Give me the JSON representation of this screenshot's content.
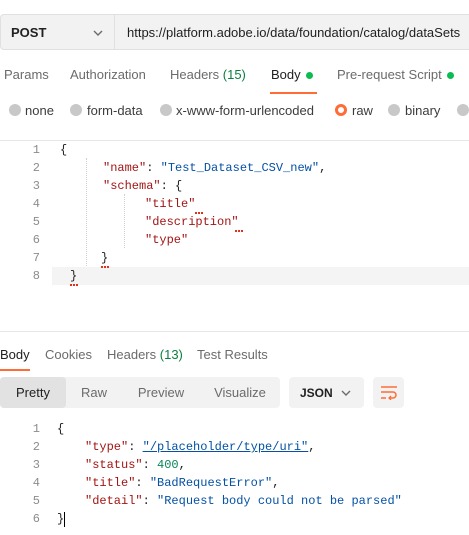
{
  "request": {
    "method": "POST",
    "url": "https://platform.adobe.io/data/foundation/catalog/dataSets"
  },
  "request_tabs": {
    "params": "Params",
    "authorization": "Authorization",
    "headers": "Headers",
    "headers_count": "(15)",
    "body": "Body",
    "prerequest": "Pre-request Script"
  },
  "body_types": {
    "none": "none",
    "form_data": "form-data",
    "urlencoded": "x-www-form-urlencoded",
    "raw": "raw",
    "binary": "binary",
    "selected": "raw"
  },
  "request_body": {
    "line_numbers": [
      "1",
      "2",
      "3",
      "4",
      "5",
      "6",
      "7",
      "8"
    ],
    "open_brace": "{",
    "name_key": "\"name\"",
    "colon": ":",
    "name_value": "\"Test_Dataset_CSV_new\"",
    "comma": ",",
    "schema_key": "\"schema\"",
    "schema_open": "{",
    "title_key": "\"title\"",
    "description_key": "\"description\"",
    "type_key": "\"type\"",
    "schema_close": "}",
    "close_brace": "}"
  },
  "response_tabs": {
    "body": "Body",
    "cookies": "Cookies",
    "headers": "Headers",
    "headers_count": "(13)",
    "test_results": "Test Results"
  },
  "view_modes": {
    "pretty": "Pretty",
    "raw": "Raw",
    "preview": "Preview",
    "visualize": "Visualize",
    "format": "JSON"
  },
  "response_body": {
    "line_numbers": [
      "1",
      "2",
      "3",
      "4",
      "5",
      "6"
    ],
    "open_brace": "{",
    "type_key": "\"type\"",
    "type_value": "\"/placeholder/type/uri\"",
    "status_key": "\"status\"",
    "status_value": "400",
    "title_key": "\"title\"",
    "title_value": "\"BadRequestError\"",
    "detail_key": "\"detail\"",
    "detail_value": "\"Request body could not be parsed\"",
    "close_brace": "}"
  },
  "colors": {
    "accent": "#ff6c37",
    "active_dot": "#0cbb52",
    "json_key": "#a31515",
    "json_string": "#0451a5",
    "json_number": "#098658"
  }
}
